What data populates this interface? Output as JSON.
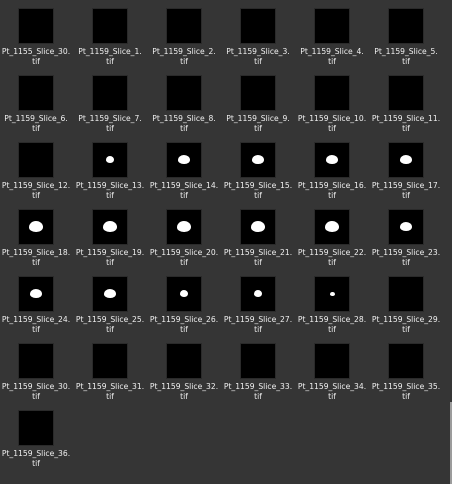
{
  "files": [
    {
      "name": "Pt_1155_Slice_30.",
      "ext": "tif",
      "mask": null
    },
    {
      "name": "Pt_1159_Slice_1.",
      "ext": "tif",
      "mask": null
    },
    {
      "name": "Pt_1159_Slice_2.",
      "ext": "tif",
      "mask": null
    },
    {
      "name": "Pt_1159_Slice_3.",
      "ext": "tif",
      "mask": null
    },
    {
      "name": "Pt_1159_Slice_4.",
      "ext": "tif",
      "mask": null
    },
    {
      "name": "Pt_1159_Slice_5.",
      "ext": "tif",
      "mask": null
    },
    {
      "name": "Pt_1159_Slice_6.",
      "ext": "tif",
      "mask": null
    },
    {
      "name": "Pt_1159_Slice_7.",
      "ext": "tif",
      "mask": null
    },
    {
      "name": "Pt_1159_Slice_8.",
      "ext": "tif",
      "mask": null
    },
    {
      "name": "Pt_1159_Slice_9.",
      "ext": "tif",
      "mask": null
    },
    {
      "name": "Pt_1159_Slice_10.",
      "ext": "tif",
      "mask": null
    },
    {
      "name": "Pt_1159_Slice_11.",
      "ext": "tif",
      "mask": null
    },
    {
      "name": "Pt_1159_Slice_12.",
      "ext": "tif",
      "mask": null
    },
    {
      "name": "Pt_1159_Slice_13.",
      "ext": "tif",
      "mask": "small"
    },
    {
      "name": "Pt_1159_Slice_14.",
      "ext": "tif",
      "mask": "medium"
    },
    {
      "name": "Pt_1159_Slice_15.",
      "ext": "tif",
      "mask": "medium"
    },
    {
      "name": "Pt_1159_Slice_16.",
      "ext": "tif",
      "mask": "medium"
    },
    {
      "name": "Pt_1159_Slice_17.",
      "ext": "tif",
      "mask": "medium"
    },
    {
      "name": "Pt_1159_Slice_18.",
      "ext": "tif",
      "mask": "large"
    },
    {
      "name": "Pt_1159_Slice_19.",
      "ext": "tif",
      "mask": "large"
    },
    {
      "name": "Pt_1159_Slice_20.",
      "ext": "tif",
      "mask": "large"
    },
    {
      "name": "Pt_1159_Slice_21.",
      "ext": "tif",
      "mask": "large"
    },
    {
      "name": "Pt_1159_Slice_22.",
      "ext": "tif",
      "mask": "large"
    },
    {
      "name": "Pt_1159_Slice_23.",
      "ext": "tif",
      "mask": "medium"
    },
    {
      "name": "Pt_1159_Slice_24.",
      "ext": "tif",
      "mask": "medium"
    },
    {
      "name": "Pt_1159_Slice_25.",
      "ext": "tif",
      "mask": "medium"
    },
    {
      "name": "Pt_1159_Slice_26.",
      "ext": "tif",
      "mask": "small"
    },
    {
      "name": "Pt_1159_Slice_27.",
      "ext": "tif",
      "mask": "small"
    },
    {
      "name": "Pt_1159_Slice_28.",
      "ext": "tif",
      "mask": "tiny"
    },
    {
      "name": "Pt_1159_Slice_29.",
      "ext": "tif",
      "mask": null
    },
    {
      "name": "Pt_1159_Slice_30.",
      "ext": "tif",
      "mask": null
    },
    {
      "name": "Pt_1159_Slice_31.",
      "ext": "tif",
      "mask": null
    },
    {
      "name": "Pt_1159_Slice_32.",
      "ext": "tif",
      "mask": null
    },
    {
      "name": "Pt_1159_Slice_33.",
      "ext": "tif",
      "mask": null
    },
    {
      "name": "Pt_1159_Slice_34.",
      "ext": "tif",
      "mask": null
    },
    {
      "name": "Pt_1159_Slice_35.",
      "ext": "tif",
      "mask": null
    },
    {
      "name": "Pt_1159_Slice_36.",
      "ext": "tif",
      "mask": null
    }
  ],
  "colors": {
    "background": "#353535",
    "thumbnail": "#000000",
    "mask": "#ffffff",
    "label": "#f0f0f0"
  }
}
